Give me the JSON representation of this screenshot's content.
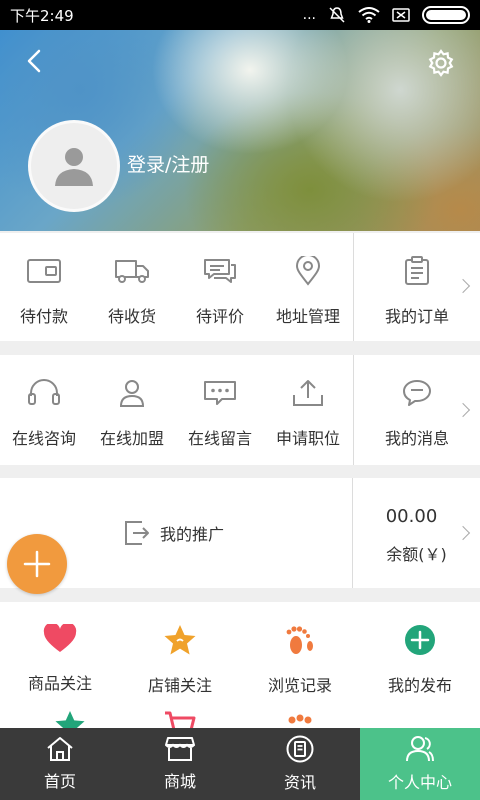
{
  "status": {
    "time": "下午2:49",
    "dots": "..."
  },
  "profile": {
    "login_label": "登录/注册"
  },
  "orders": {
    "items": [
      {
        "label": "待付款",
        "icon": "wallet-icon"
      },
      {
        "label": "待收货",
        "icon": "truck-icon"
      },
      {
        "label": "待评价",
        "icon": "chat-icon"
      },
      {
        "label": "地址管理",
        "icon": "location-pin-icon"
      }
    ],
    "side": {
      "label": "我的订单",
      "icon": "clipboard-icon"
    }
  },
  "services": {
    "items": [
      {
        "label": "在线咨询",
        "icon": "headset-icon"
      },
      {
        "label": "在线加盟",
        "icon": "person-icon"
      },
      {
        "label": "在线留言",
        "icon": "message-dots-icon"
      },
      {
        "label": "申请职位",
        "icon": "upload-icon"
      }
    ],
    "side": {
      "label": "我的消息",
      "icon": "speech-bubble-icon"
    }
  },
  "promo": {
    "label": "我的推广",
    "balance_value": "00.00",
    "balance_label": "余额(￥)"
  },
  "favorites": {
    "items": [
      {
        "label": "商品关注",
        "icon": "heart-icon",
        "color": "#ef4a63"
      },
      {
        "label": "店铺关注",
        "icon": "star-icon",
        "color": "#f0a22b"
      },
      {
        "label": "浏览记录",
        "icon": "footprints-icon",
        "color": "#f07a3e"
      },
      {
        "label": "我的发布",
        "icon": "plus-circle-icon",
        "color": "#22a57a"
      }
    ]
  },
  "tabs": [
    {
      "label": "首页",
      "icon": "home-icon"
    },
    {
      "label": "商城",
      "icon": "store-icon"
    },
    {
      "label": "资讯",
      "icon": "news-icon"
    },
    {
      "label": "个人中心",
      "icon": "user-icon",
      "active": true
    }
  ],
  "colors": {
    "accent": "#4cc28a",
    "fab": "#f19a3e",
    "tabbar": "#3a3a3a"
  }
}
